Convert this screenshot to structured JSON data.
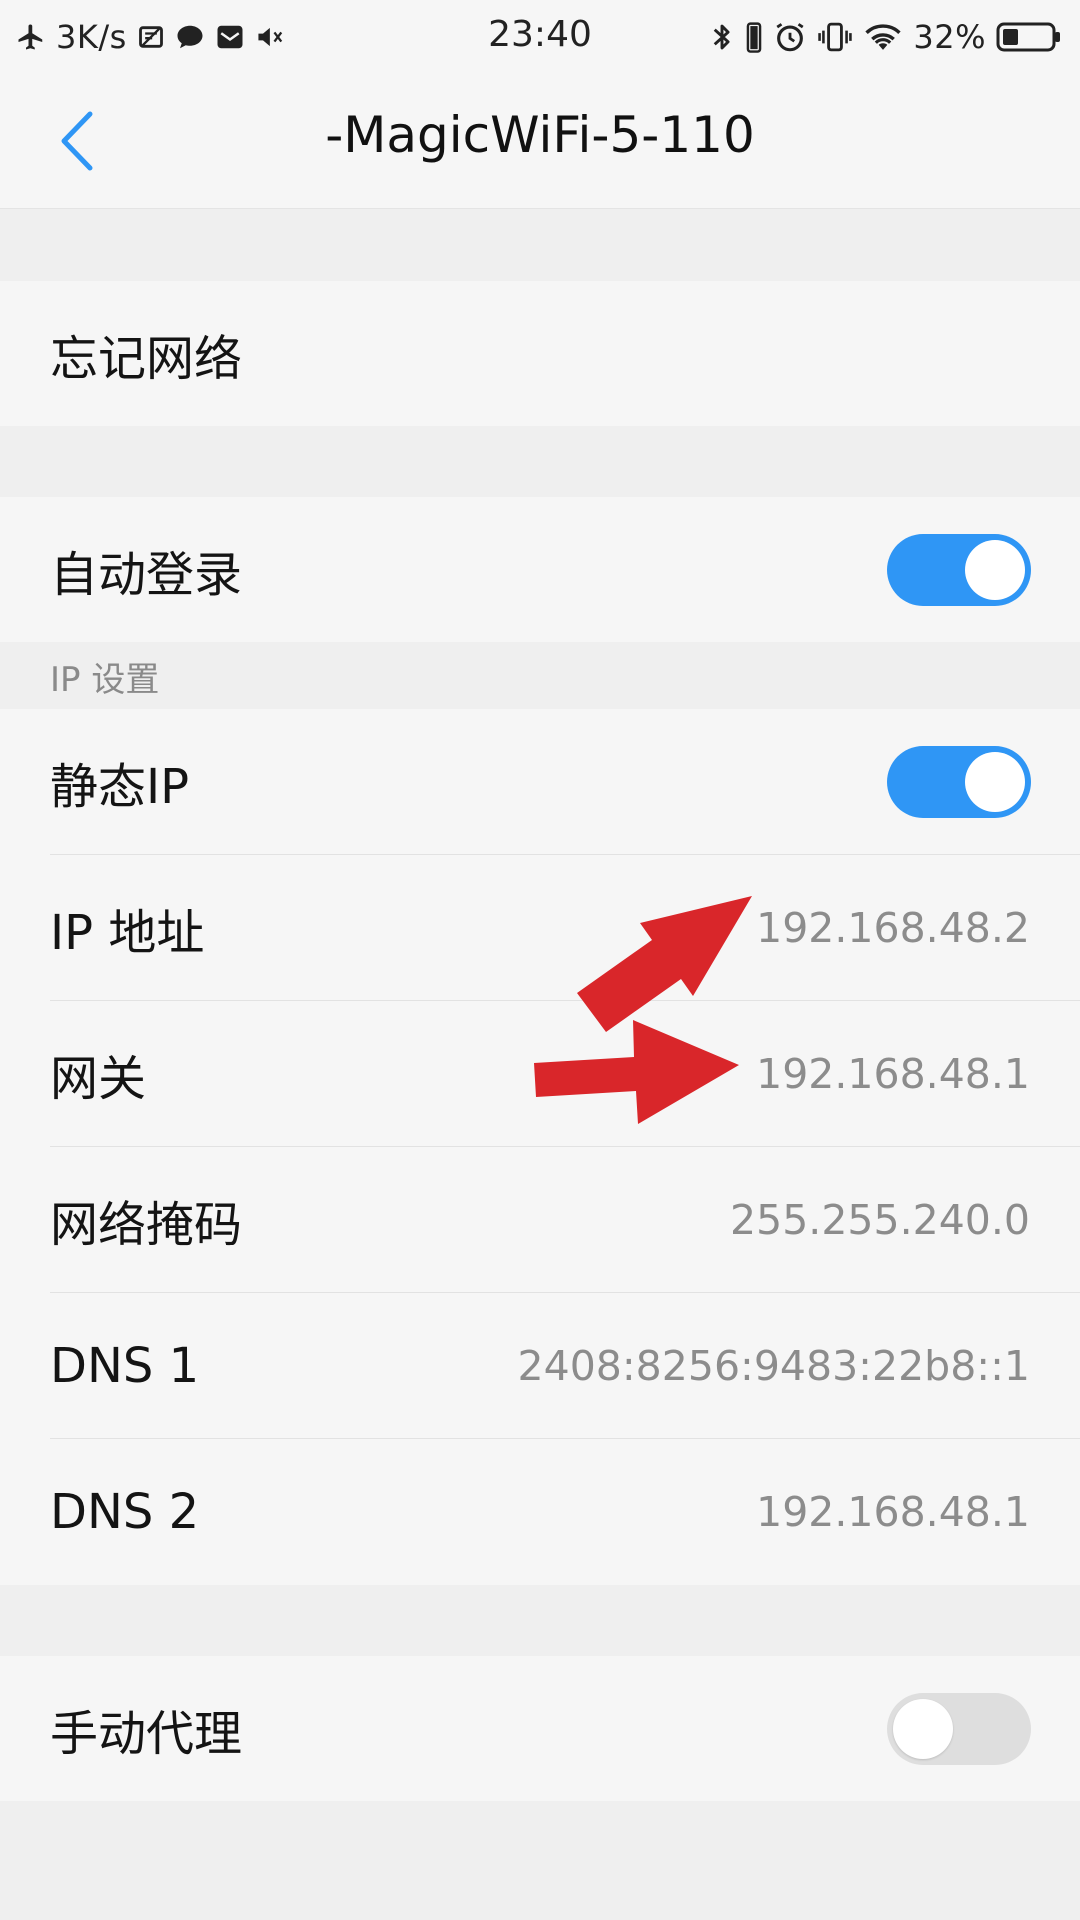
{
  "status_bar": {
    "speed": "3K/s",
    "time": "23:40",
    "battery": "32%",
    "battery_level": 0.32,
    "icons_left": [
      "airplane-mode-icon",
      "screenshot-icon",
      "message-icon",
      "mail-icon",
      "mute-icon"
    ],
    "icons_right": [
      "bluetooth-icon",
      "battery-saver-icon",
      "alarm-icon",
      "vibrate-icon",
      "wifi-icon",
      "battery-icon"
    ]
  },
  "header": {
    "title": "-MagicWiFi-5-110",
    "back_icon": "chevron-left-icon"
  },
  "forget_network": {
    "label": "忘记网络"
  },
  "auto_login": {
    "label": "自动登录",
    "enabled": true
  },
  "ip_settings": {
    "section_label": "IP 设置",
    "static_ip": {
      "label": "静态IP",
      "enabled": true
    },
    "fields": [
      {
        "label": "IP 地址",
        "value": "192.168.48.2"
      },
      {
        "label": "网关",
        "value": "192.168.48.1"
      },
      {
        "label": "网络掩码",
        "value": "255.255.240.0"
      },
      {
        "label": "DNS 1",
        "value": "2408:8256:9483:22b8::1"
      },
      {
        "label": "DNS 2",
        "value": "192.168.48.1"
      }
    ]
  },
  "manual_proxy": {
    "label": "手动代理",
    "enabled": false
  },
  "colors": {
    "accent": "#2f96f5",
    "toggle_off": "#dedede",
    "annotation_arrow": "#d9262a",
    "background": "#efefef",
    "row_background": "#f6f6f6"
  }
}
